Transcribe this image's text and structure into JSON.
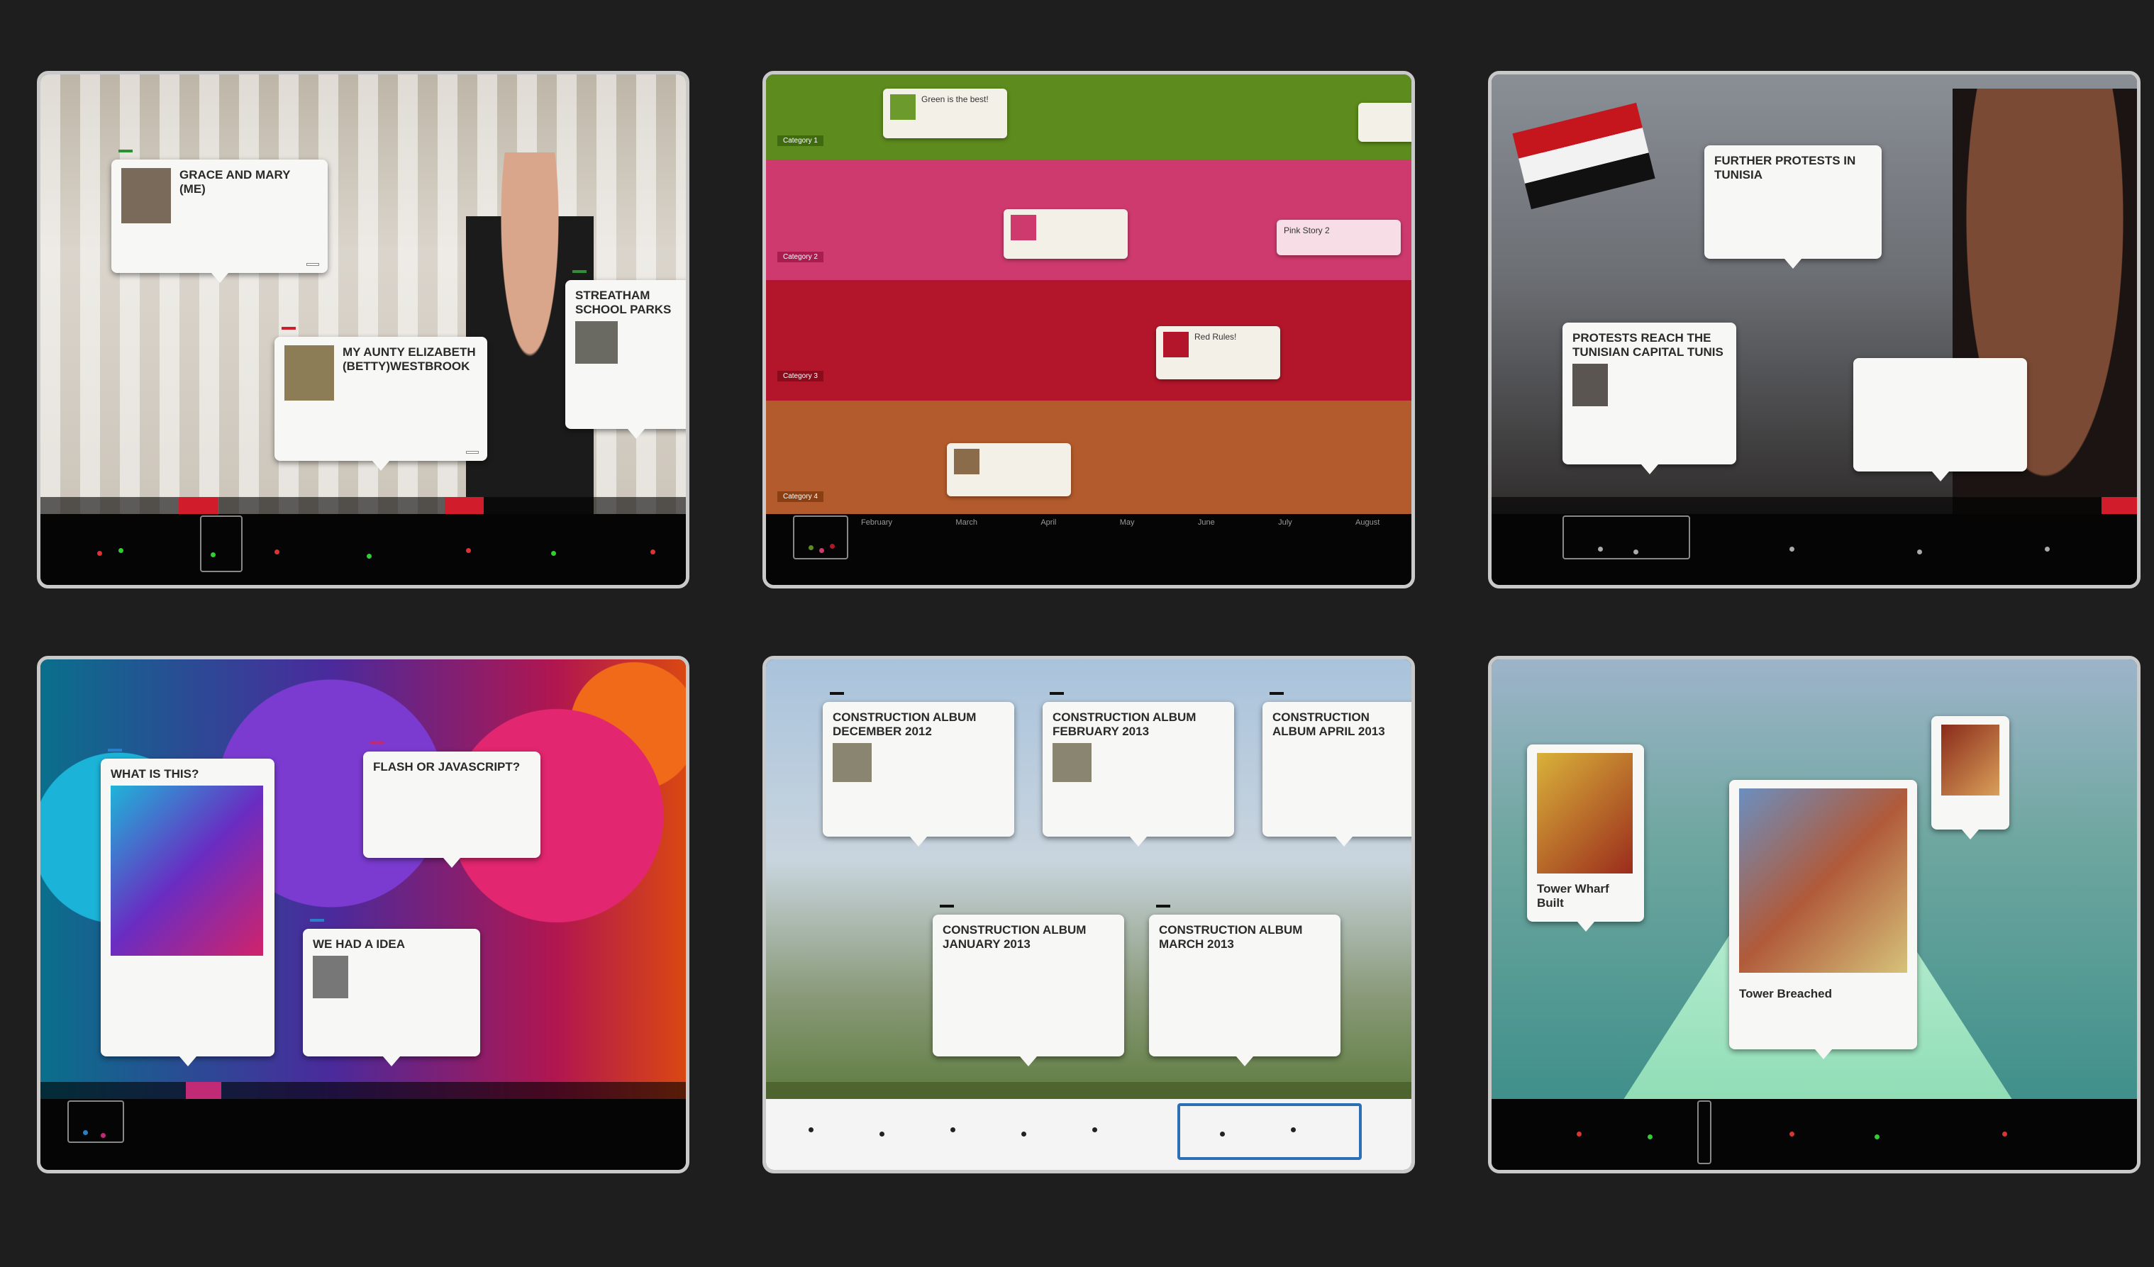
{
  "gallery": {
    "background": "#1e1e1e",
    "panels": [
      {
        "id": "p1",
        "header_label": "",
        "cards": [
          {
            "tag": "",
            "title": "GRACE AND MARY (ME)",
            "text": "",
            "more": ""
          },
          {
            "tag": "",
            "title": "MY AUNTY ELIZABETH (BETTY)WESTBROOK",
            "text": "",
            "more": ""
          },
          {
            "tag": "",
            "title": "STREATHAM SCHOOL PARKS",
            "text": "",
            "more": ""
          }
        ],
        "highlight": "",
        "ticks": [
          "",
          "",
          "",
          "",
          "",
          "",
          "",
          ""
        ]
      },
      {
        "id": "p2",
        "bands": [
          {
            "label": "Category 1",
            "color": "#5d8b1d"
          },
          {
            "label": "Category 2",
            "color": "#cf3a6e"
          },
          {
            "label": "Category 3",
            "color": "#b3162a"
          },
          {
            "label": "Category 4",
            "color": "#b35b2c"
          }
        ],
        "items": [
          {
            "title": "Green is the best!",
            "date": ""
          },
          {
            "title": "",
            "date": ""
          },
          {
            "title": "Pink Story 2",
            "date": ""
          },
          {
            "title": "Red Rules!",
            "date": ""
          },
          {
            "title": "",
            "date": ""
          },
          {
            "title": "",
            "date": ""
          }
        ],
        "ticks": [
          "",
          "February",
          "March",
          "April",
          "May",
          "June",
          "July",
          "August"
        ]
      },
      {
        "id": "p3",
        "cards": [
          {
            "title": "FURTHER PROTESTS IN TUNISIA",
            "date": "",
            "text": ""
          },
          {
            "title": "PROTESTS REACH THE TUNISIAN CAPITAL TUNIS",
            "date": "",
            "text": ""
          },
          {
            "title": "",
            "date": "",
            "text": ""
          }
        ],
        "ticks": [
          "",
          "",
          "",
          "",
          "",
          "",
          ""
        ]
      },
      {
        "id": "p4",
        "cards": [
          {
            "tag": "",
            "title": "WHAT IS THIS?",
            "date": "",
            "text": ""
          },
          {
            "tag": "",
            "title": "FLASH OR JAVASCRIPT?",
            "date": "",
            "text": ""
          },
          {
            "tag": "",
            "title": "WE HAD A IDEA",
            "date": "",
            "text": ""
          }
        ],
        "ticks": [
          "",
          "",
          "",
          "",
          "",
          "",
          ""
        ]
      },
      {
        "id": "p5",
        "cards": [
          {
            "tag": "",
            "title": "CONSTRUCTION ALBUM DECEMBER 2012",
            "date": "",
            "text": ""
          },
          {
            "tag": "",
            "title": "CONSTRUCTION ALBUM FEBRUARY 2013",
            "date": "",
            "text": ""
          },
          {
            "tag": "",
            "title": "CONSTRUCTION ALBUM APRIL 2013",
            "date": "",
            "text": ""
          },
          {
            "tag": "",
            "title": "CONSTRUCTION ALBUM JANUARY 2013",
            "date": "",
            "text": ""
          },
          {
            "tag": "",
            "title": "CONSTRUCTION ALBUM MARCH 2013",
            "date": "",
            "text": ""
          }
        ],
        "ticks": [
          "",
          "",
          "",
          "",
          "",
          ""
        ]
      },
      {
        "id": "p6",
        "cards": [
          {
            "title": "Tower Wharf Built"
          },
          {
            "title": "Tower Breached"
          },
          {
            "title": ""
          }
        ],
        "ticks": [
          "",
          "",
          "",
          "",
          ""
        ]
      }
    ]
  }
}
